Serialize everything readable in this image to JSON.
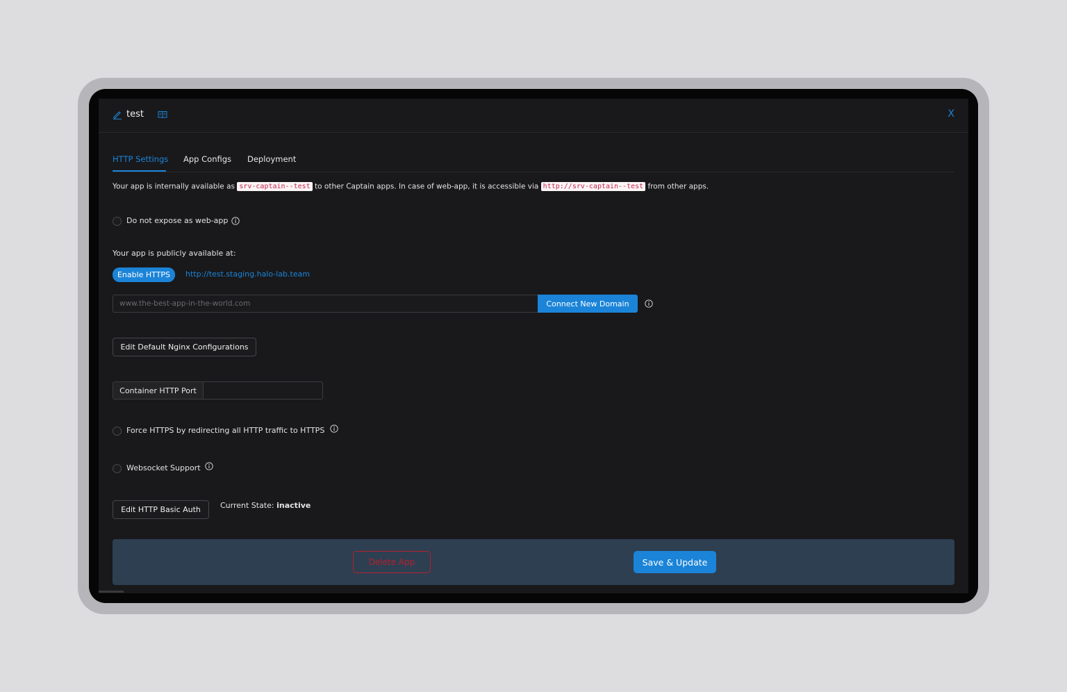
{
  "header": {
    "app_name": "test",
    "close_label": "X"
  },
  "tabs": [
    {
      "label": "HTTP Settings",
      "active": true
    },
    {
      "label": "App Configs",
      "active": false
    },
    {
      "label": "Deployment",
      "active": false
    }
  ],
  "internal": {
    "prefix": "Your app is internally available as",
    "service_name": "srv-captain--test",
    "middle": "to other Captain apps. In case of web-app, it is accessible via",
    "service_url": "http://srv-captain--test",
    "suffix": "from other apps."
  },
  "no_expose": {
    "label": "Do not expose as web-app",
    "checked": false
  },
  "public": {
    "heading": "Your app is publicly available at:",
    "enable_https_label": "Enable HTTPS",
    "url": "http://test.staging.halo-lab.team"
  },
  "domain": {
    "placeholder": "www.the-best-app-in-the-world.com",
    "connect_label": "Connect New Domain"
  },
  "nginx_button": "Edit Default Nginx Configurations",
  "port": {
    "label": "Container HTTP Port",
    "value": ""
  },
  "force_https": {
    "label": "Force HTTPS by redirecting all HTTP traffic to HTTPS",
    "checked": false
  },
  "websocket": {
    "label": "Websocket Support",
    "checked": false
  },
  "basic_auth": {
    "button": "Edit HTTP Basic Auth",
    "state_prefix": "Current State:",
    "state_value": "inactive"
  },
  "footer": {
    "delete_label": "Delete App",
    "save_label": "Save & Update"
  },
  "colors": {
    "accent": "#1b84d8",
    "danger": "#b3212c",
    "background": "#19191b",
    "footer": "#2e3f52"
  }
}
